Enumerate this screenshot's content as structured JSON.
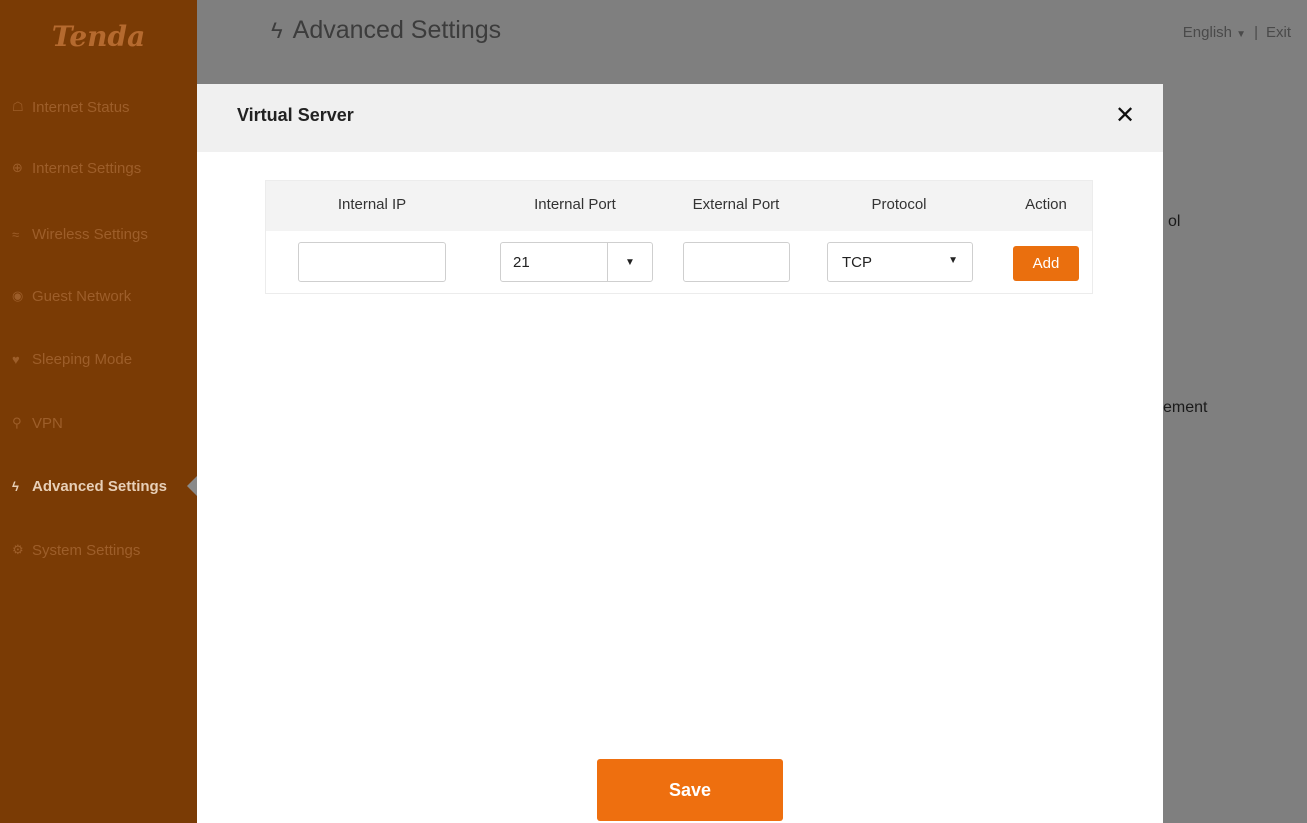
{
  "app": {
    "logo": "Tenda",
    "page_title": "Advanced Settings",
    "language": "English",
    "separator": "|",
    "exit": "Exit"
  },
  "sidebar": {
    "items": [
      {
        "label": "Internet Status",
        "icon": "router-icon"
      },
      {
        "label": "Internet Settings",
        "icon": "globe-icon"
      },
      {
        "label": "Wireless Settings",
        "icon": "wifi-icon"
      },
      {
        "label": "Guest Network",
        "icon": "guest-icon"
      },
      {
        "label": "Sleeping Mode",
        "icon": "bulb-icon"
      },
      {
        "label": "VPN",
        "icon": "vpn-icon"
      },
      {
        "label": "Advanced Settings",
        "icon": "wrench-icon",
        "active": true
      },
      {
        "label": "System Settings",
        "icon": "gear-icon"
      }
    ]
  },
  "background": {
    "partial_1": "ol",
    "partial_2": "ement"
  },
  "modal": {
    "title": "Virtual Server",
    "close": "✕",
    "columns": [
      "Internal IP",
      "Internal Port",
      "External Port",
      "Protocol",
      "Action"
    ],
    "row": {
      "internal_ip": "",
      "internal_port": "21",
      "external_port": "",
      "protocol": "TCP",
      "action": "Add"
    },
    "save": "Save"
  },
  "colors": {
    "sidebar_bg": "#7a3b05",
    "accent": "#ee6f0f",
    "overlay": "#7f7f7f"
  }
}
